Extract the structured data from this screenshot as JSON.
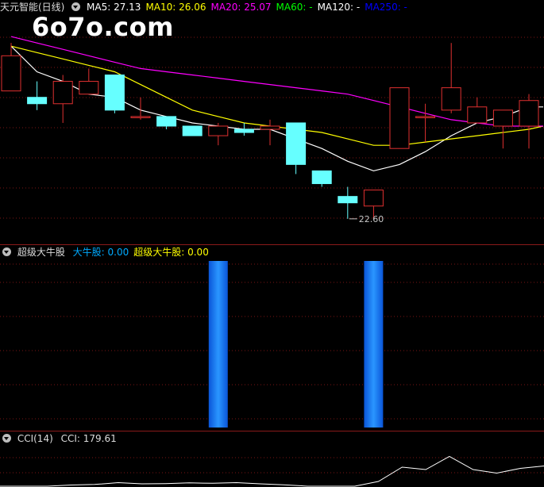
{
  "main_panel": {
    "title": "天元智能(日线)",
    "ma_items": [
      {
        "label": "MA5: 27.13",
        "color": "#ffffff"
      },
      {
        "label": "MA10: 26.06",
        "color": "#ffff00"
      },
      {
        "label": "MA20: 25.07",
        "color": "#ff00ff"
      },
      {
        "label": "MA60: -",
        "color": "#00ff00"
      },
      {
        "label": "MA120: -",
        "color": "#ffffff"
      },
      {
        "label": "MA250: -",
        "color": "#0000ff"
      }
    ],
    "low_label": "22.60"
  },
  "watermark": "6o7o.com",
  "indicator_panel": {
    "title": "超级大牛股",
    "items": [
      {
        "label": "大牛股: 0.00",
        "color": "#00aaff"
      },
      {
        "label": "超级大牛股: 0.00",
        "color": "#ffff00"
      }
    ],
    "bar_positions": [
      8,
      14
    ],
    "bar_value": 1
  },
  "cci_panel": {
    "title": "CCI(14)",
    "value_label": "CCI: 179.61",
    "values": [
      -155,
      -150,
      -140,
      -130,
      -125,
      -110,
      -120,
      -118,
      -112,
      -115,
      -110,
      -120,
      -128,
      -140,
      -150,
      -160,
      -100,
      20,
      0,
      110,
      0,
      -30,
      10,
      30
    ]
  },
  "chart_data": {
    "type": "candlestick",
    "ohlc": [
      {
        "o": 26.6,
        "h": 28.1,
        "l": 26.6,
        "c": 27.7
      },
      {
        "o": 26.4,
        "h": 26.9,
        "l": 26.0,
        "c": 26.2
      },
      {
        "o": 26.2,
        "h": 27.1,
        "l": 25.6,
        "c": 26.9
      },
      {
        "o": 26.5,
        "h": 27.3,
        "l": 26.5,
        "c": 26.9
      },
      {
        "o": 27.1,
        "h": 27.1,
        "l": 25.9,
        "c": 26.0
      },
      {
        "o": 25.8,
        "h": 26.4,
        "l": 25.7,
        "c": 25.8
      },
      {
        "o": 25.8,
        "h": 25.8,
        "l": 25.4,
        "c": 25.5
      },
      {
        "o": 25.5,
        "h": 25.5,
        "l": 25.2,
        "c": 25.2
      },
      {
        "o": 25.2,
        "h": 25.6,
        "l": 24.9,
        "c": 25.5
      },
      {
        "o": 25.4,
        "h": 25.6,
        "l": 25.2,
        "c": 25.3
      },
      {
        "o": 25.4,
        "h": 25.7,
        "l": 24.9,
        "c": 25.5
      },
      {
        "o": 25.6,
        "h": 25.6,
        "l": 24.0,
        "c": 24.3
      },
      {
        "o": 24.1,
        "h": 24.1,
        "l": 23.6,
        "c": 23.7
      },
      {
        "o": 23.3,
        "h": 23.6,
        "l": 22.6,
        "c": 23.1
      },
      {
        "o": 23.0,
        "h": 23.5,
        "l": 22.6,
        "c": 23.5
      },
      {
        "o": 24.8,
        "h": 26.7,
        "l": 24.8,
        "c": 26.7
      },
      {
        "o": 25.8,
        "h": 26.2,
        "l": 25.0,
        "c": 25.8
      },
      {
        "o": 26.0,
        "h": 28.1,
        "l": 25.9,
        "c": 26.7
      },
      {
        "o": 25.6,
        "h": 26.4,
        "l": 25.6,
        "c": 26.1
      },
      {
        "o": 25.5,
        "h": 26.0,
        "l": 24.8,
        "c": 26.0
      },
      {
        "o": 25.5,
        "h": 26.5,
        "l": 24.8,
        "c": 26.3
      }
    ],
    "ma_lines": {
      "MA5": [
        28.0,
        27.2,
        26.9,
        26.5,
        26.4,
        26.0,
        25.8,
        25.6,
        25.5,
        25.4,
        25.4,
        25.1,
        24.8,
        24.4,
        24.1,
        24.3,
        24.7,
        25.2,
        25.6,
        25.8,
        26.1,
        26.1
      ],
      "MA10": [
        28.0,
        27.8,
        27.6,
        27.4,
        27.2,
        26.8,
        26.4,
        26.0,
        25.8,
        25.6,
        25.5,
        25.4,
        25.3,
        25.1,
        24.9,
        24.9,
        25.0,
        25.1,
        25.2,
        25.3,
        25.4,
        25.5
      ],
      "MA20": [
        28.3,
        28.1,
        27.9,
        27.7,
        27.5,
        27.3,
        27.2,
        27.1,
        27.0,
        26.9,
        26.8,
        26.7,
        26.6,
        26.5,
        26.3,
        26.1,
        25.9,
        25.7,
        25.6,
        25.5,
        25.5,
        25.5
      ]
    },
    "line_colors": {
      "MA5": "#ffffff",
      "MA10": "#ffff00",
      "MA20": "#ff00ff"
    },
    "up_color": "#e03030",
    "down_color": "#66ffff"
  }
}
